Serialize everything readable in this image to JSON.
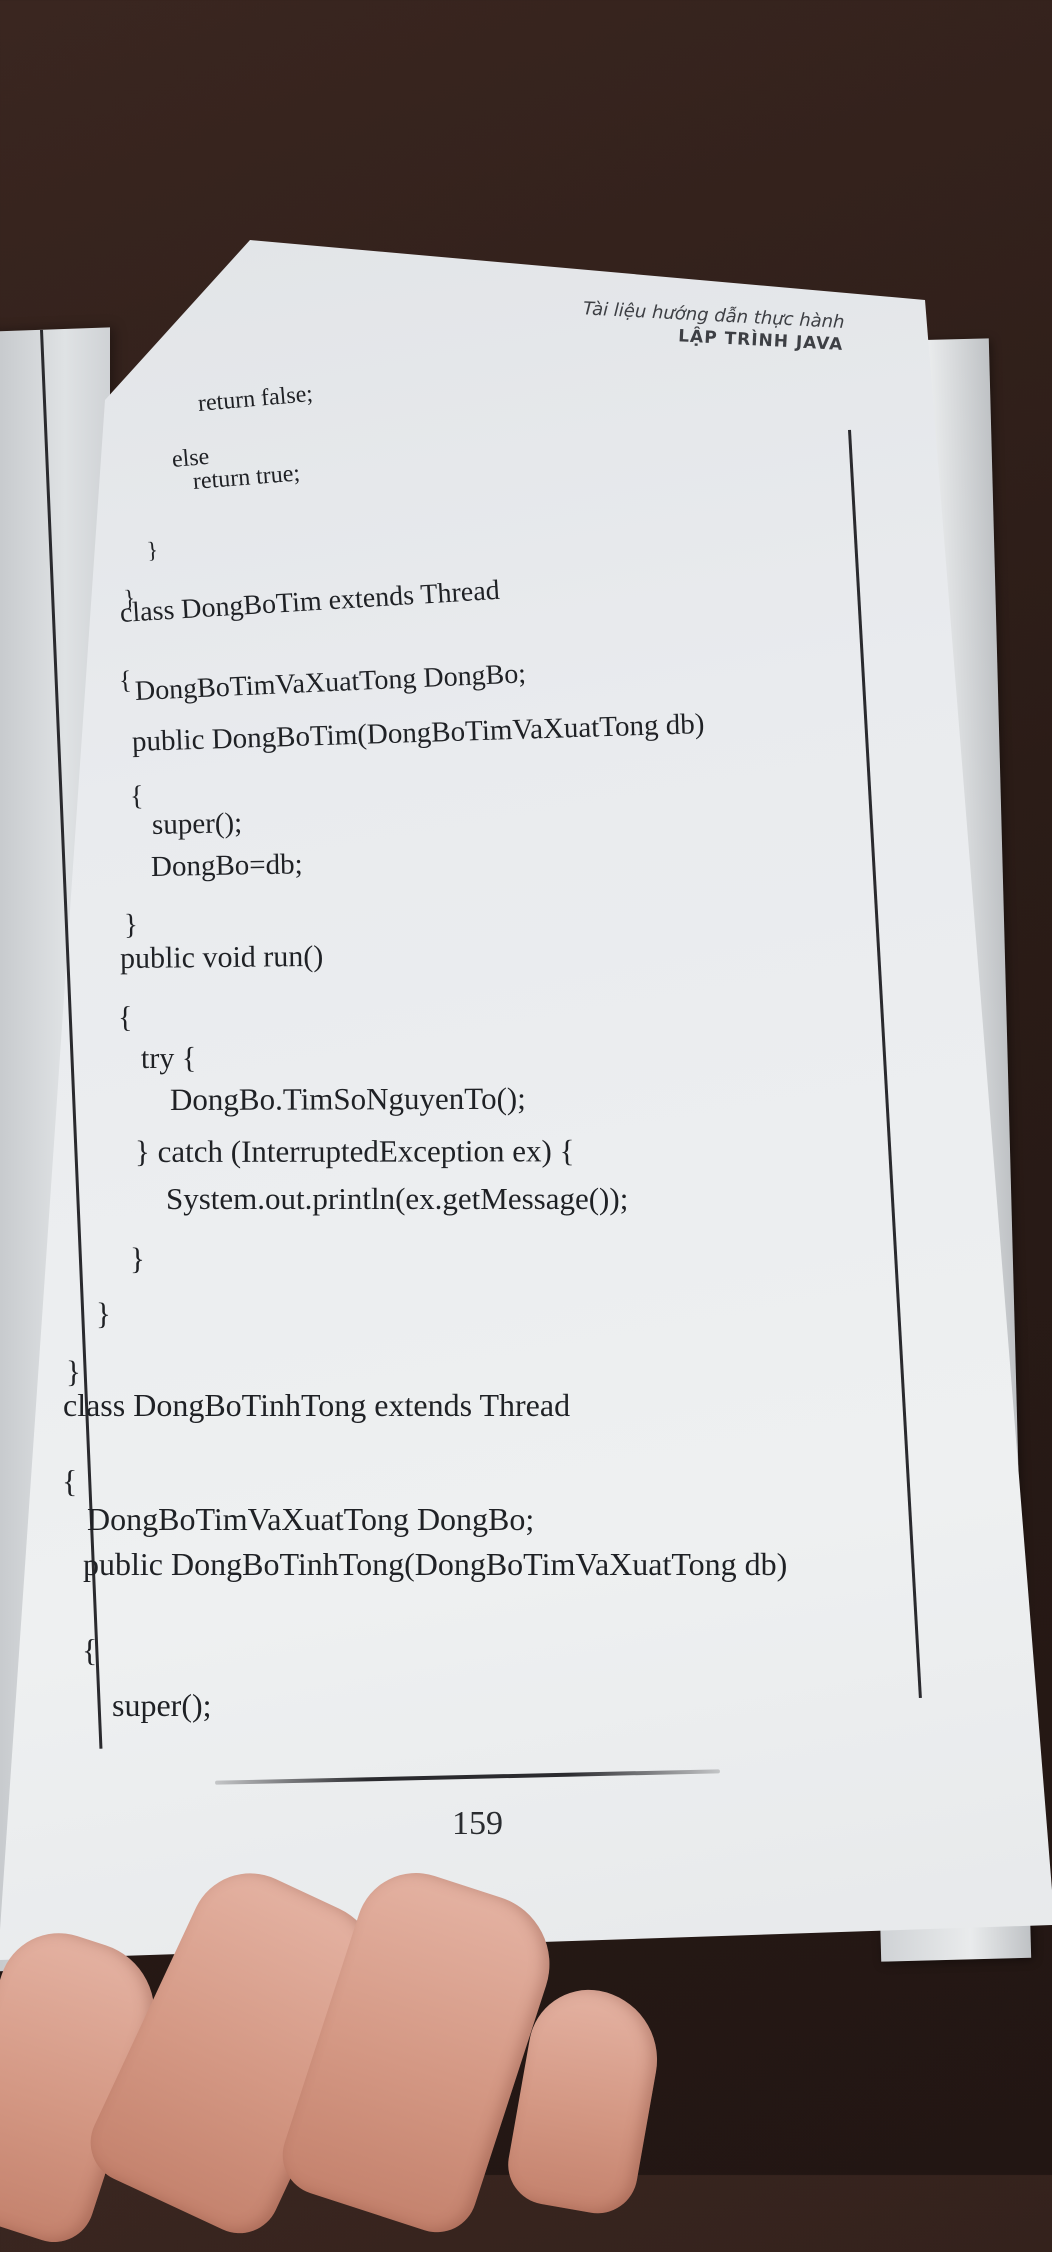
{
  "header": {
    "subtitle": "Tài liệu hướng dẫn thực hành",
    "title": "LẬP TRÌNH JAVA"
  },
  "code_lines": [
    "return false;",
    "else",
    "return true;",
    "}",
    "}",
    "class DongBoTim extends Thread",
    "{",
    "DongBoTimVaXuatTong DongBo;",
    "public DongBoTim(DongBoTimVaXuatTong db)",
    "{",
    "super();",
    "DongBo=db;",
    "}",
    "public void run()",
    "{",
    "try {",
    "DongBo.TimSoNguyenTo();",
    "} catch (InterruptedException ex) {",
    "System.out.println(ex.getMessage());",
    "}",
    "}",
    "}",
    "class DongBoTinhTong extends Thread",
    "{",
    "DongBoTimVaXuatTong DongBo;",
    "public DongBoTinhTong(DongBoTimVaXuatTong db)",
    "{",
    "super();"
  ],
  "footer": {
    "page_number": "159"
  }
}
